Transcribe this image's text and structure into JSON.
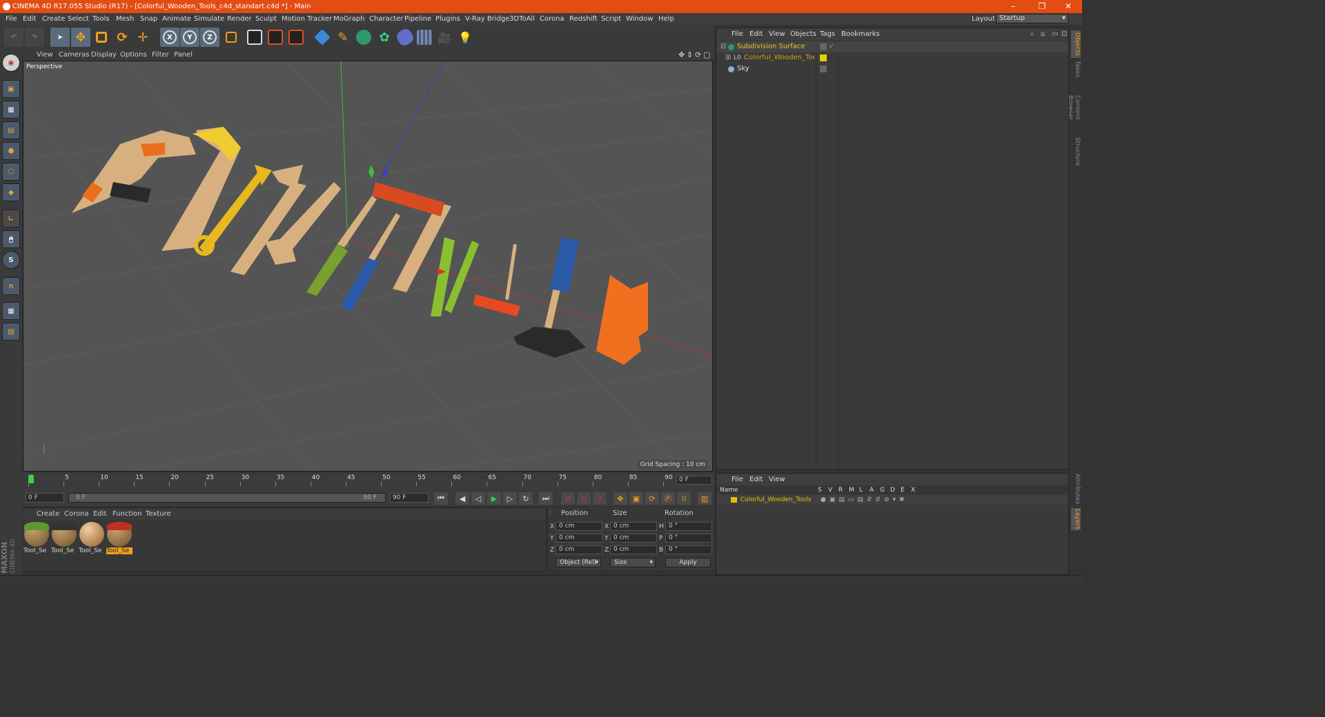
{
  "window": {
    "title": "CINEMA 4D R17.055 Studio (R17) - [Colorful_Wooden_Tools_c4d_standart.c4d *] - Main",
    "minimize": "–",
    "maximize": "❐",
    "close": "✕"
  },
  "menubar": {
    "items": [
      "File",
      "Edit",
      "Create",
      "Select",
      "Tools",
      "Mesh",
      "Snap",
      "Animate",
      "Simulate",
      "Render",
      "Sculpt",
      "Motion Tracker",
      "MoGraph",
      "Character",
      "Pipeline",
      "Plugins",
      "V-Ray Bridge",
      "3DToAll",
      "Corona",
      "Redshift",
      "Script",
      "Window",
      "Help"
    ],
    "layout_label": "Layout:",
    "layout_value": "Startup"
  },
  "toolbar": {
    "axis_x": "X",
    "axis_y": "Y",
    "axis_z": "Z"
  },
  "viewport": {
    "menu": [
      "View",
      "Cameras",
      "Display",
      "Options",
      "Filter",
      "Panel"
    ],
    "name": "Perspective",
    "grid_spacing": "Grid Spacing : 10 cm"
  },
  "timeline": {
    "ticks": [
      "0",
      "5",
      "10",
      "15",
      "20",
      "25",
      "30",
      "35",
      "40",
      "45",
      "50",
      "55",
      "60",
      "65",
      "70",
      "75",
      "80",
      "85",
      "90"
    ],
    "current_frame": "0 F",
    "start_field": "0 F",
    "range_start": "0 F",
    "range_end": "90 F",
    "end_field": "90 F"
  },
  "materials": {
    "menu": [
      "Create",
      "Corona",
      "Edit",
      "Function",
      "Texture"
    ],
    "items": [
      {
        "label": "Tool_Se",
        "color": "#6a8a3a"
      },
      {
        "label": "Tool_Se",
        "color": "#555555"
      },
      {
        "label": "Tool_Se",
        "color": "#c9a070"
      },
      {
        "label": "Tool_Se",
        "color": "#c03020"
      }
    ]
  },
  "coordinates": {
    "headers": [
      "Position",
      "Size",
      "Rotation"
    ],
    "rows": [
      {
        "axis": "X",
        "pos": "0 cm",
        "size_axis": "X",
        "size": "0 cm",
        "rot_axis": "H",
        "rot": "0 °"
      },
      {
        "axis": "Y",
        "pos": "0 cm",
        "size_axis": "Y",
        "size": "0 cm",
        "rot_axis": "P",
        "rot": "0 °"
      },
      {
        "axis": "Z",
        "pos": "0 cm",
        "size_axis": "Z",
        "size": "0 cm",
        "rot_axis": "B",
        "rot": "0 °"
      }
    ],
    "mode": "Object (Rel)",
    "size_mode": "Size",
    "apply": "Apply"
  },
  "objects": {
    "menu": [
      "File",
      "Edit",
      "View",
      "Objects",
      "Tags",
      "Bookmarks"
    ],
    "items": [
      {
        "name": "Subdivision Surface",
        "color": "#f0c030"
      },
      {
        "name": "Colorful_Wooden_Tools",
        "color": "#d4a017"
      },
      {
        "name": "Sky",
        "color": "#dddddd"
      }
    ]
  },
  "layers": {
    "menu": [
      "File",
      "Edit",
      "View"
    ],
    "header_name": "Name",
    "header_flags": [
      "S",
      "V",
      "R",
      "M",
      "L",
      "A",
      "G",
      "D",
      "E",
      "X"
    ],
    "items": [
      {
        "name": "Colorful_Wooden_Tools",
        "color": "#e8c000"
      }
    ]
  },
  "right_tabs": [
    "Objects",
    "Takes",
    "Content Browser",
    "Structure",
    "Attributes",
    "Layers"
  ],
  "branding": {
    "maxon": "MAXON",
    "product": "CINEMA 4D"
  }
}
